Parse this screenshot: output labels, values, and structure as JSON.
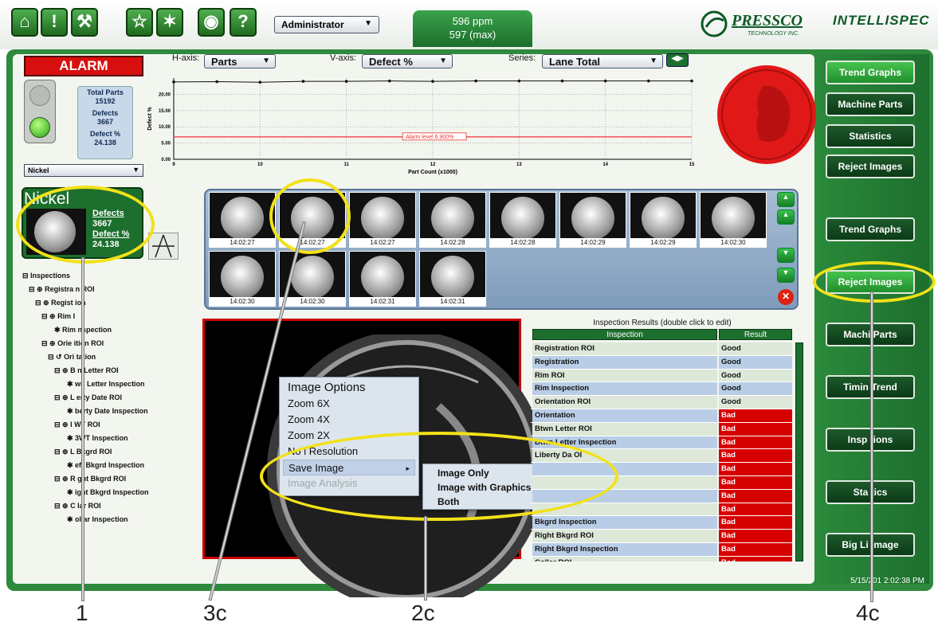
{
  "toolbar": {
    "buttons": [
      "home-icon",
      "alert-icon",
      "wrench-icon",
      "star-icon",
      "wand-icon",
      "globe-icon",
      "help-icon"
    ],
    "glyphs": [
      "⌂",
      "!",
      "⚒",
      "☆",
      "✶",
      "◉",
      "?"
    ],
    "user_select": "Administrator",
    "rate_line1": "596 ppm",
    "rate_line2": "597 (max)",
    "logo_brand": "PRESSCO",
    "logo_sub": "TECHNOLOGY INC.",
    "product": "INTELLISPEC"
  },
  "alarm": {
    "label": "ALARM"
  },
  "stats": {
    "total_parts_label": "Total Parts",
    "total_parts": "15192",
    "defects_label": "Defects",
    "defects": "3667",
    "defect_pct_label": "Defect %",
    "defect_pct": "24.138"
  },
  "product_select": "Nickel",
  "chart_controls": {
    "h_axis_label": "H-axis:",
    "h_axis_value": "Parts",
    "v_axis_label": "V-axis:",
    "v_axis_value": "Defect %",
    "series_label": "Series:",
    "series_value": "Lane Total"
  },
  "chart_data": {
    "type": "line",
    "xlabel": "Part Count (x1000)",
    "ylabel": "Defect %",
    "x_ticks": [
      "9",
      "10",
      "11",
      "12",
      "13",
      "14",
      "15"
    ],
    "y_ticks": [
      "0.00",
      "5.00",
      "10.00",
      "15.00",
      "20.00"
    ],
    "xlim": [
      9,
      15
    ],
    "ylim": [
      0,
      25
    ],
    "series": [
      {
        "x": [
          9,
          9.5,
          10,
          10.5,
          11,
          11.5,
          12,
          12.5,
          13,
          13.5,
          14,
          14.5,
          15
        ],
        "values": [
          23.8,
          23.9,
          23.7,
          24.0,
          24.0,
          24.1,
          24.0,
          24.1,
          24.1,
          24.1,
          24.1,
          24.1,
          24.1
        ]
      }
    ],
    "alarm_level": 6.9,
    "alarm_label": "Alarm level 6.900%",
    "grid": true
  },
  "nickel_panel": {
    "name": "Nickel",
    "defects_label": "Defects",
    "defects": "3667",
    "defect_pct_label": "Defect %",
    "defect_pct": "24.138"
  },
  "tree": [
    "Inspections",
    "Registra   n ROI",
    "Regist      ion",
    "Rim      I",
    "Rim   nspection",
    "Orie    ition ROI",
    "Ori    tation",
    "B    n Letter ROI",
    "wn Letter Inspection",
    "L    erty Date ROI",
    "berty Date Inspection",
    "I    WT ROI",
    "3WT Inspection",
    "L    Bkgrd ROI",
    "eft Bkgrd Inspection",
    "R    ght Bkgrd ROI",
    "ight Bkgrd Inspection",
    "C    lar ROI",
    "ollar Inspection"
  ],
  "thumbnails": [
    "14:02:27",
    "14:02:27",
    "14:02:27",
    "14:02:28",
    "14:02:28",
    "14:02:29",
    "14:02:29",
    "14:02:30",
    "14:02:30",
    "14:02:30",
    "14:02:31",
    "14:02:31"
  ],
  "context_menu": {
    "title": "Image Options",
    "items": [
      "Zoom 6X",
      "Zoom 4X",
      "Zoom 2X",
      "No    l Resolution",
      "Save Image",
      "Image Analysis"
    ],
    "submenu": [
      "Image Only",
      "Image with Graphics",
      "Both"
    ]
  },
  "results": {
    "title": "Inspection Results (double click to edit)",
    "col_inspection": "Inspection",
    "col_result": "Result",
    "rows": [
      {
        "name": "Registration ROI",
        "result": "Good"
      },
      {
        "name": "Registration",
        "result": "Good"
      },
      {
        "name": "Rim ROI",
        "result": "Good"
      },
      {
        "name": "Rim Inspection",
        "result": "Good"
      },
      {
        "name": "Orientation ROI",
        "result": "Good"
      },
      {
        "name": "Orientation",
        "result": "Bad"
      },
      {
        "name": "Btwn Letter ROI",
        "result": "Bad"
      },
      {
        "name": "Btwn Letter Inspection",
        "result": "Bad"
      },
      {
        "name": "Liberty Da   OI",
        "result": "Bad"
      },
      {
        "name": "",
        "result": "Bad"
      },
      {
        "name": "",
        "result": "Bad"
      },
      {
        "name": "",
        "result": "Bad"
      },
      {
        "name": "",
        "result": "Bad"
      },
      {
        "name": "    Bkgrd Inspection",
        "result": "Bad"
      },
      {
        "name": "Right Bkgrd ROI",
        "result": "Bad"
      },
      {
        "name": "Right Bkgrd Inspection",
        "result": "Bad"
      },
      {
        "name": "Collar ROI",
        "result": "Bad"
      }
    ]
  },
  "right_top": [
    "Trend Graphs",
    "Machine Parts",
    "Statistics",
    "Reject Images"
  ],
  "right_bottom": [
    "Trend Graphs",
    "Reject Images",
    "Machi   Parts",
    "Timin   Trend",
    "Insp   tions",
    "Sta   tics",
    "Big Li   Image"
  ],
  "timestamp": "5/15/201   2:02:38 PM",
  "callouts": [
    "1",
    "3c",
    "2c",
    "4c"
  ],
  "highlight_color": "#f2e118"
}
